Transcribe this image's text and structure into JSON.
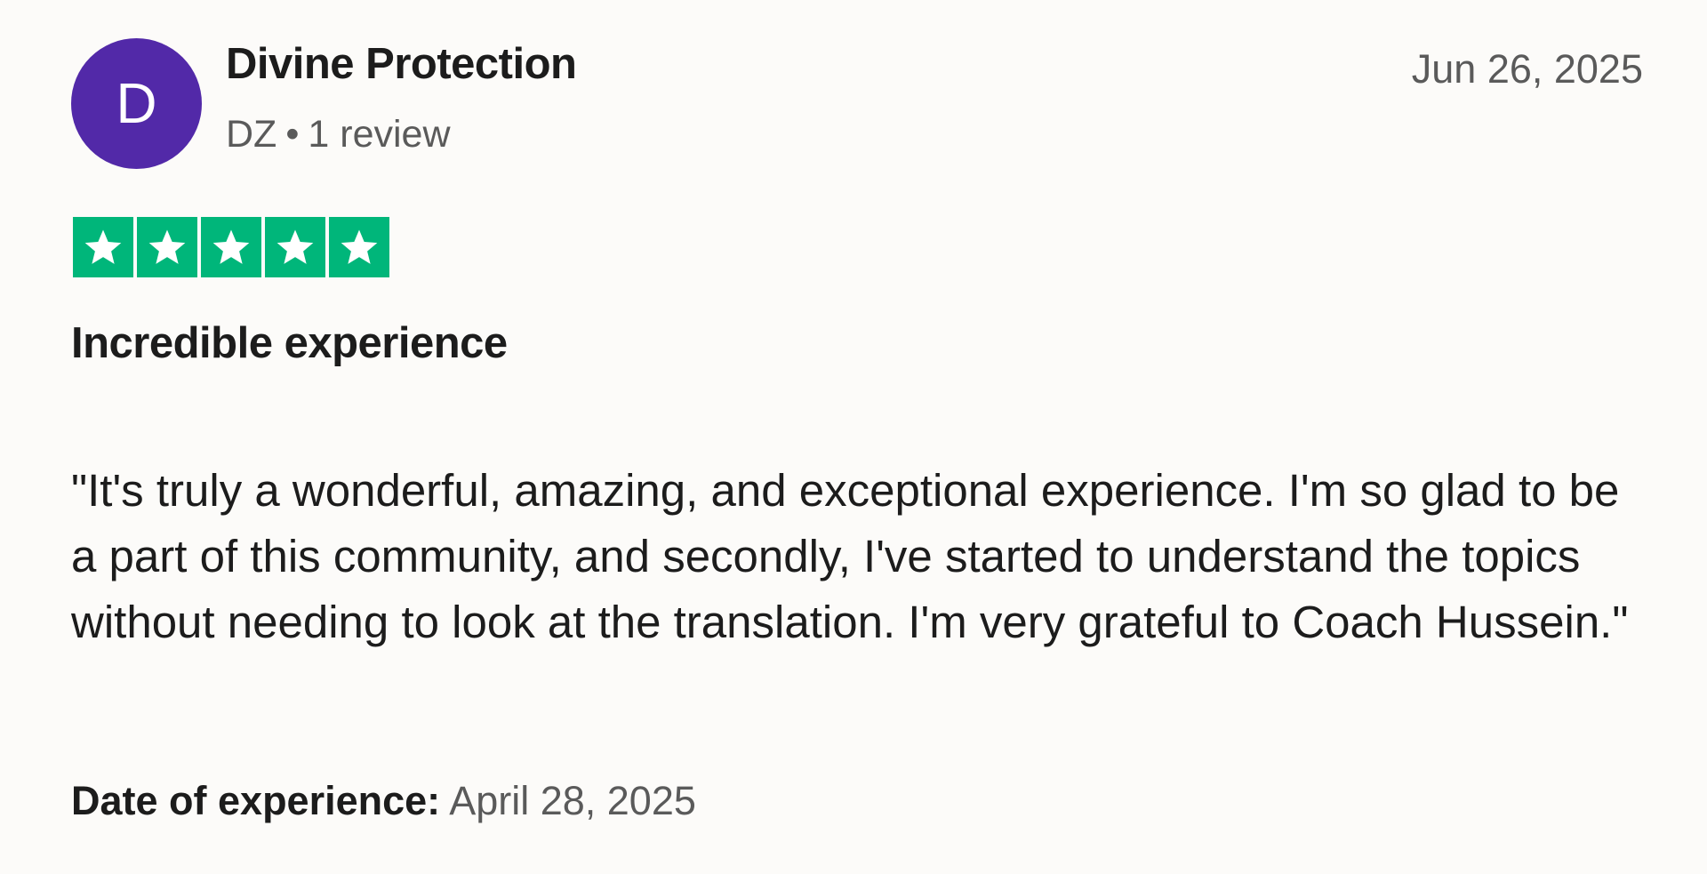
{
  "reviewer": {
    "initial": "D",
    "name": "Divine Protection",
    "country": "DZ",
    "separator": "•",
    "review_count": "1 review",
    "avatar_color": "#5229a8"
  },
  "review": {
    "date": "Jun 26, 2025",
    "rating": 5,
    "rating_max": 5,
    "star_color": "#00b67a",
    "title": "Incredible experience",
    "body": "\"It's truly a wonderful, amazing, and exceptional experience. I'm so glad to be a part of this community, and secondly, I've started to understand the topics without needing to look at the translation. I'm very grateful to Coach Hussein.\"",
    "experience_label": "Date of experience:",
    "experience_date": "April 28, 2025"
  }
}
